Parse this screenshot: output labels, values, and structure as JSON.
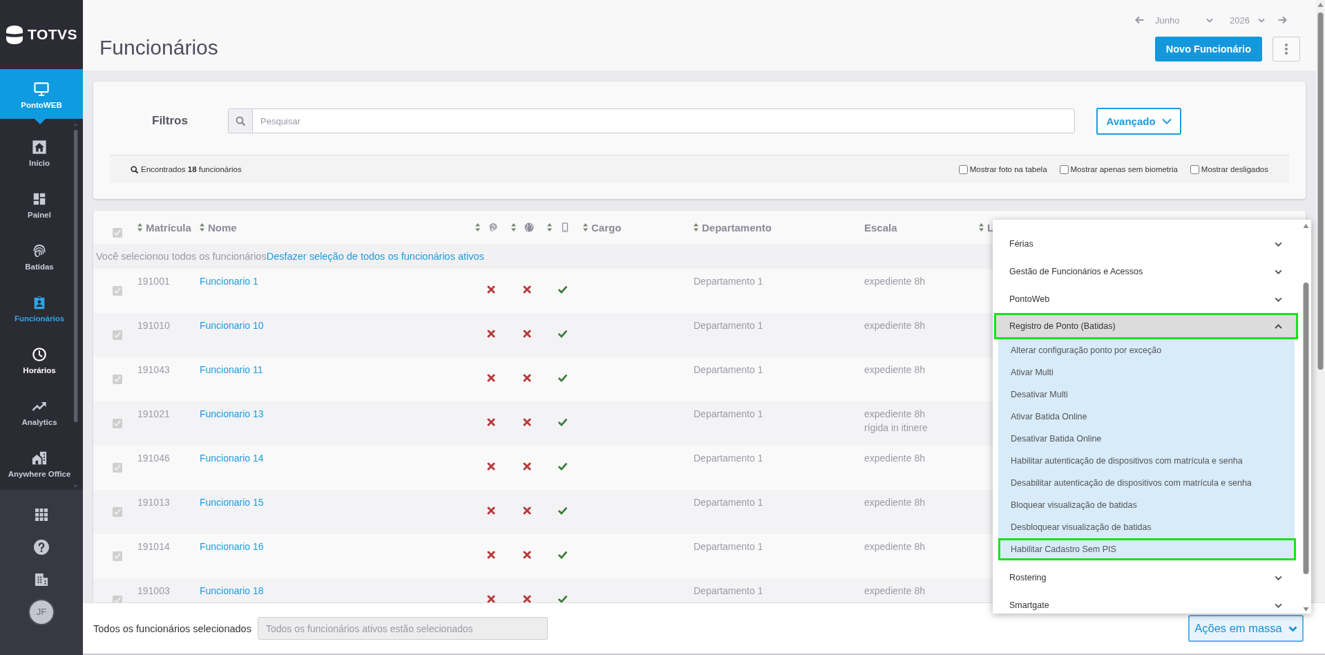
{
  "sidebar": {
    "logo": "TOTVS",
    "module": {
      "label": "PontoWEB"
    },
    "items": [
      {
        "label": "Início",
        "selected": false,
        "hovered": false
      },
      {
        "label": "Painel",
        "selected": false,
        "hovered": false
      },
      {
        "label": "Batidas",
        "selected": false,
        "hovered": false
      },
      {
        "label": "Funcionários",
        "selected": true,
        "hovered": false
      },
      {
        "label": "Horários",
        "selected": false,
        "hovered": true
      },
      {
        "label": "Analytics",
        "selected": false,
        "hovered": false
      },
      {
        "label": "Anywhere Office",
        "selected": false,
        "hovered": false
      }
    ],
    "user": {
      "initials": "JF"
    }
  },
  "header": {
    "title": "Funcionários",
    "period": {
      "month": "Junho",
      "year": "2026"
    },
    "new_button": "Novo Funcionário"
  },
  "filters": {
    "label": "Filtros",
    "search": {
      "placeholder": "Pesquisar"
    },
    "advanced_button": "Avançado",
    "result": "Encontrados **18** funcionários",
    "options": [
      {
        "label": "Mostrar foto na tabela",
        "checked": false
      },
      {
        "label": "Mostrar apenas sem biometria",
        "checked": false
      },
      {
        "label": "Mostrar desligados",
        "checked": false
      }
    ]
  },
  "table": {
    "select_all": {
      "checked": true,
      "disabled": true
    },
    "columns": [
      {
        "kind": "text",
        "label": "Matrícula",
        "sortable": true
      },
      {
        "kind": "text",
        "label": "Nome",
        "sortable": true
      },
      {
        "kind": "status",
        "sortable": true
      },
      {
        "kind": "status",
        "sortable": true
      },
      {
        "kind": "status",
        "sortable": true
      },
      {
        "kind": "text",
        "label": "Cargo",
        "sortable": true
      },
      {
        "kind": "text",
        "label": "Departamento",
        "sortable": true
      },
      {
        "kind": "text",
        "label": "Escala",
        "sortable": false
      },
      {
        "kind": "text",
        "label": "L",
        "sortable": true
      }
    ],
    "notice": {
      "text": "Você selecionou todos os funcionários",
      "link": "Desfazer seleção de todos os funcionários ativos"
    },
    "rows": [
      {
        "checked": true,
        "disabled": true,
        "matricula": "191001",
        "nome": "Funcionario 1",
        "status": [
          false,
          false,
          true
        ],
        "departamento": "Departamento 1",
        "escala": [
          "expediente 8h"
        ]
      },
      {
        "checked": true,
        "disabled": true,
        "matricula": "191010",
        "nome": "Funcionario 10",
        "status": [
          false,
          false,
          true
        ],
        "departamento": "Departamento 1",
        "escala": [
          "expediente 8h"
        ]
      },
      {
        "checked": true,
        "disabled": true,
        "matricula": "191043",
        "nome": "Funcionario 11",
        "status": [
          false,
          false,
          true
        ],
        "departamento": "Departamento 1",
        "escala": [
          "expediente 8h"
        ]
      },
      {
        "checked": true,
        "disabled": true,
        "matricula": "191021",
        "nome": "Funcionario 13",
        "status": [
          false,
          false,
          true
        ],
        "departamento": "Departamento 1",
        "escala": [
          "expediente 8h",
          "rígida in itinere"
        ]
      },
      {
        "checked": true,
        "disabled": true,
        "matricula": "191046",
        "nome": "Funcionario 14",
        "status": [
          false,
          false,
          true
        ],
        "departamento": "Departamento 1",
        "escala": [
          "expediente 8h"
        ]
      },
      {
        "checked": true,
        "disabled": true,
        "matricula": "191013",
        "nome": "Funcionario 15",
        "status": [
          false,
          false,
          true
        ],
        "departamento": "Departamento 1",
        "escala": [
          "expediente 8h"
        ]
      },
      {
        "checked": true,
        "disabled": true,
        "matricula": "191014",
        "nome": "Funcionario 16",
        "status": [
          false,
          false,
          true
        ],
        "departamento": "Departamento 1",
        "escala": [
          "expediente 8h"
        ]
      },
      {
        "checked": true,
        "disabled": true,
        "matricula": "191003",
        "nome": "Funcionario 18",
        "status": [
          false,
          false,
          true
        ],
        "departamento": "Departamento 1",
        "escala": [
          "expediente 8h"
        ]
      }
    ]
  },
  "footer": {
    "label": "Todos os funcionários selecionados",
    "field": {
      "value": "Todos os funcionários ativos estão selecionados",
      "disabled": true
    },
    "mass_actions": {
      "label": "Ações em massa",
      "expanded": true
    }
  },
  "actions_menu": {
    "groups": [
      {
        "label": "Férias",
        "expanded": false,
        "highlighted": false
      },
      {
        "label": "Gestão de Funcionários e Acessos",
        "expanded": false,
        "highlighted": false
      },
      {
        "label": "PontoWeb",
        "expanded": false,
        "highlighted": false
      },
      {
        "label": "Registro de Ponto (Batidas)",
        "expanded": true,
        "highlighted": true,
        "children": [
          {
            "label": "Alterar configuração ponto por exceção",
            "highlighted": false
          },
          {
            "label": "Ativar Multi",
            "highlighted": false
          },
          {
            "label": "Desativar Multi",
            "highlighted": false
          },
          {
            "label": "Ativar Batida Online",
            "highlighted": false
          },
          {
            "label": "Desativar Batida Online",
            "highlighted": false
          },
          {
            "label": "Habilitar autenticação de dispositivos com matrícula e senha",
            "highlighted": false
          },
          {
            "label": "Desabilitar autenticação de dispositivos com matrícula e senha",
            "highlighted": false
          },
          {
            "label": "Bloquear visualização de batidas",
            "highlighted": false
          },
          {
            "label": "Desbloquear visualização de batidas",
            "highlighted": false
          },
          {
            "label": "Habilitar Cadastro Sem PIS",
            "highlighted": true
          }
        ]
      },
      {
        "label": "Rostering",
        "expanded": false,
        "highlighted": false
      },
      {
        "label": "Smartgate",
        "expanded": false,
        "highlighted": false
      }
    ]
  }
}
